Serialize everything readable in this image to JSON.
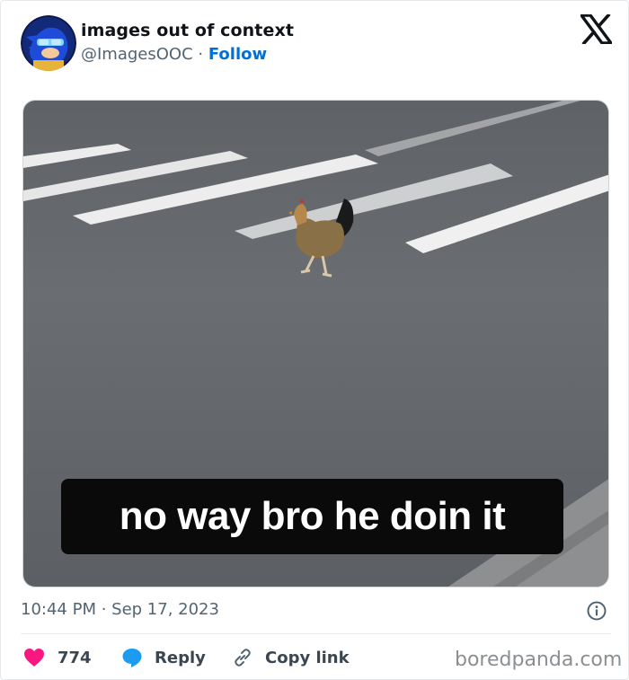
{
  "tweet": {
    "author_name": "images out of context",
    "handle": "@ImagesOOC",
    "separator": "·",
    "follow_label": "Follow",
    "brand_icon": "x-logo-icon",
    "media": {
      "caption": "no way bro he doin it",
      "subject": "chicken crossing a crosswalk"
    },
    "timestamp": "10:44 PM · Sep 17, 2023",
    "info_icon": "info-icon",
    "actions": {
      "likes": "774",
      "reply_label": "Reply",
      "copy_link_label": "Copy link"
    }
  },
  "watermark": "boredpanda.com",
  "colors": {
    "follow_blue": "#006fd6",
    "like_red": "#f91880",
    "reply_blue": "#1d9bf0",
    "muted_gray": "#536471"
  }
}
